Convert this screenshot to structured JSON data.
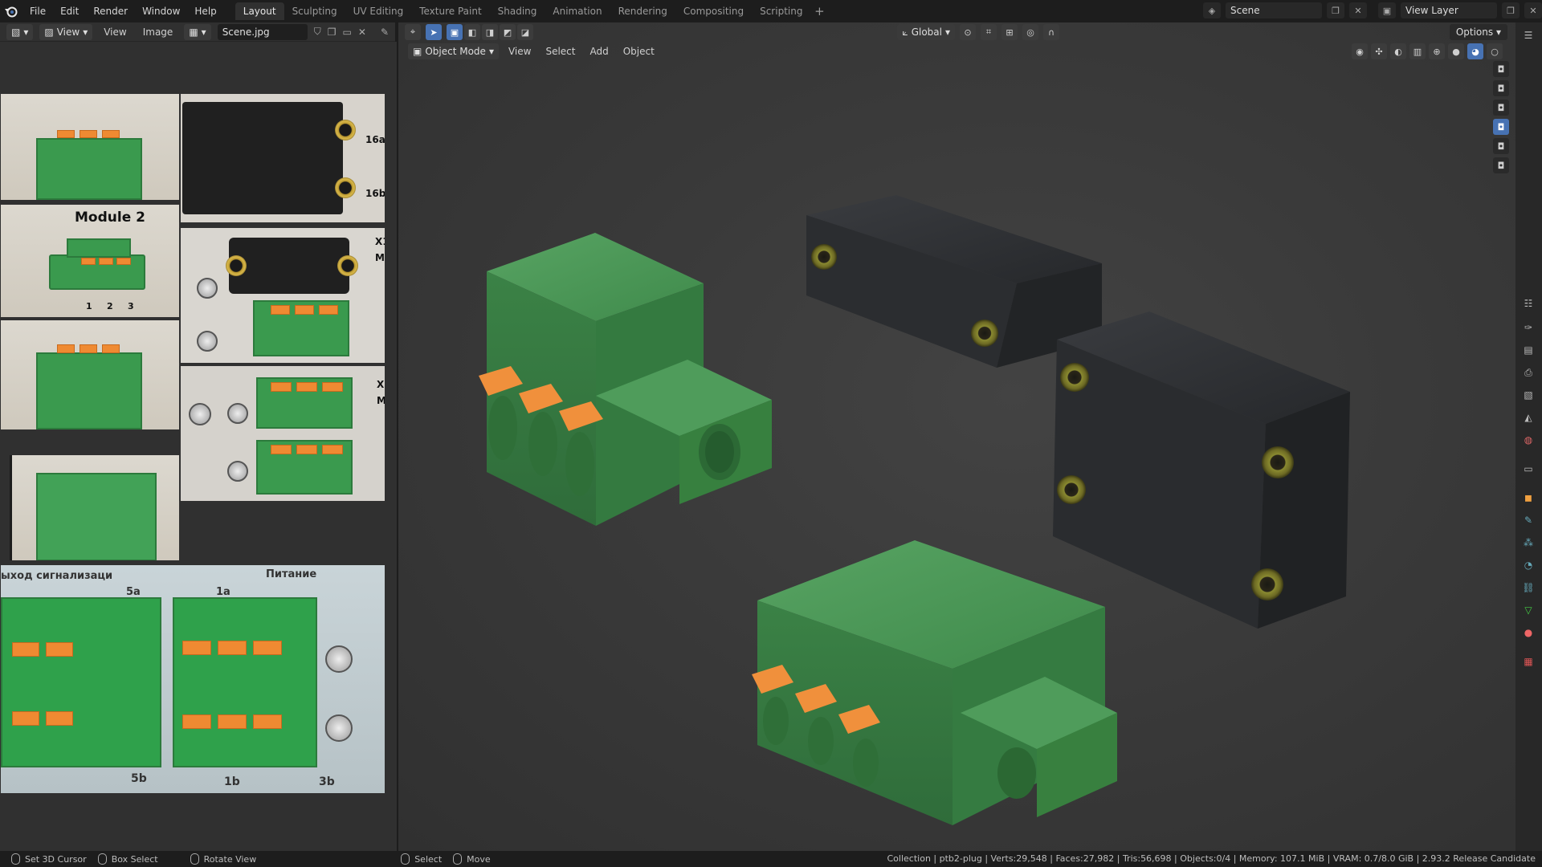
{
  "menu": {
    "items": [
      "File",
      "Edit",
      "Render",
      "Window",
      "Help"
    ]
  },
  "workspaces": {
    "tabs": [
      "Layout",
      "Sculpting",
      "UV Editing",
      "Texture Paint",
      "Shading",
      "Animation",
      "Rendering",
      "Compositing",
      "Scripting"
    ],
    "active": "Layout",
    "add_label": "+"
  },
  "scene": {
    "scene_name": "Scene",
    "view_layer": "View Layer"
  },
  "image_editor": {
    "view_label": "View",
    "menu_view": "View",
    "menu_image": "Image",
    "image_name": "Scene.jpg",
    "photo_labels": {
      "module": "Module 2",
      "pin_1": "1",
      "pin_2": "2",
      "pin_3": "3",
      "label_16a": "16a",
      "label_16b": "16b",
      "label_x1": "X1",
      "label_m1": "M",
      "label_x2": "X",
      "label_m2": "M",
      "label_5a": "5a",
      "label_1a": "1a",
      "label_5b": "5b",
      "label_1b": "1b",
      "label_3b": "3b",
      "label_cyr_left": "ыход сигнализаци",
      "label_cyr_right": "Питание"
    }
  },
  "viewport": {
    "transform_orientation": "Global",
    "mode": "Object Mode",
    "menu_view": "View",
    "menu_select": "Select",
    "menu_add": "Add",
    "menu_object": "Object",
    "options_label": "Options"
  },
  "statusbar": {
    "set_cursor": "Set 3D Cursor",
    "box_select": "Box Select",
    "rotate_view": "Rotate View",
    "select": "Select",
    "move": "Move",
    "stats": "Collection | ptb2-plug | Verts:29,548 | Faces:27,982 | Tris:56,698 | Objects:0/4 | Memory: 107.1 MiB | VRAM: 0.7/8.0 GiB | 2.93.2 Release Candidate"
  },
  "colors": {
    "accent": "#4772b3",
    "connector_green": "#3f8c4a",
    "latch_orange": "#f0903c",
    "housing_dark": "#2e3033"
  }
}
